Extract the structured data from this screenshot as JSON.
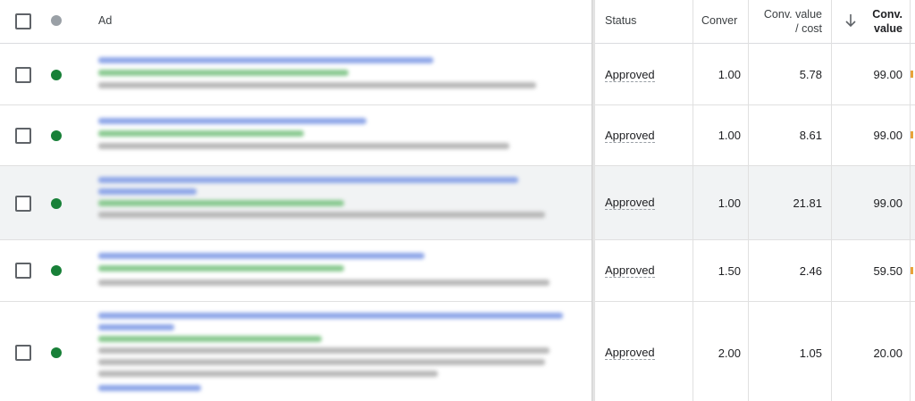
{
  "header": {
    "ad": "Ad",
    "status": "Status",
    "conversions": "Conver",
    "conv_value_cost": [
      "Conv. value",
      "/ cost"
    ],
    "conv_value": [
      "Conv.",
      "value"
    ],
    "sort_icon": "arrow-down-icon"
  },
  "colors": {
    "enabled_dot": "#188038",
    "header_dot": "#9aa0a6",
    "highlight_row": "#f1f3f4"
  },
  "rows": [
    {
      "status": "Approved",
      "conversions": "1.00",
      "conv_value_cost": "5.78",
      "conv_value": "99.00"
    },
    {
      "status": "Approved",
      "conversions": "1.00",
      "conv_value_cost": "8.61",
      "conv_value": "99.00"
    },
    {
      "status": "Approved",
      "conversions": "1.00",
      "conv_value_cost": "21.81",
      "conv_value": "99.00"
    },
    {
      "status": "Approved",
      "conversions": "1.50",
      "conv_value_cost": "2.46",
      "conv_value": "59.50"
    },
    {
      "status": "Approved",
      "conversions": "2.00",
      "conv_value_cost": "1.05",
      "conv_value": "20.00"
    }
  ]
}
